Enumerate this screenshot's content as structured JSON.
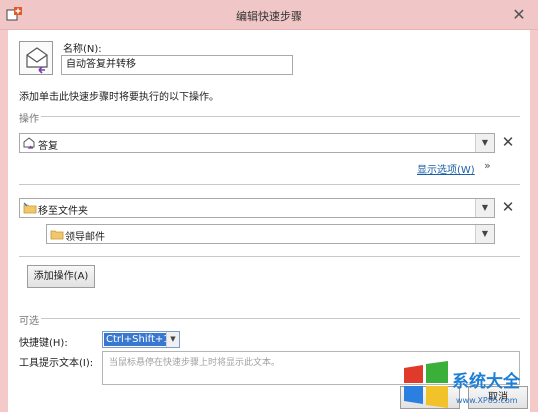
{
  "window": {
    "title": "编辑快速步骤",
    "close_glyph": "✕"
  },
  "name": {
    "label": "名称(N):",
    "value": "自动答复并转移"
  },
  "description": "添加单击此快速步骤时将要执行的以下操作。",
  "actions": {
    "section_label": "操作",
    "items": [
      {
        "label": "答复",
        "icon": "reply-mail-icon"
      },
      {
        "label": "移至文件夹",
        "icon": "folder-icon"
      }
    ],
    "folder_value": "领导邮件",
    "show_options_link": "显示选项(W)",
    "expand_glyph": "»",
    "remove_glyph": "✕",
    "add_button": "添加操作(A)"
  },
  "optional": {
    "section_label": "可选",
    "shortcut_label": "快捷键(H):",
    "shortcut_value": "Ctrl+Shift+1",
    "tooltip_label": "工具提示文本(I):",
    "tooltip_placeholder": "当鼠标悬停在快速步骤上时将显示此文本。"
  },
  "footer": {
    "cancel": "取消"
  },
  "watermark": {
    "text": "系统大全",
    "url": "www.XP85.com"
  },
  "colors": {
    "accent": "#3a78d0",
    "link": "#1a5fa8",
    "titlebar": "#f1c6c6"
  }
}
